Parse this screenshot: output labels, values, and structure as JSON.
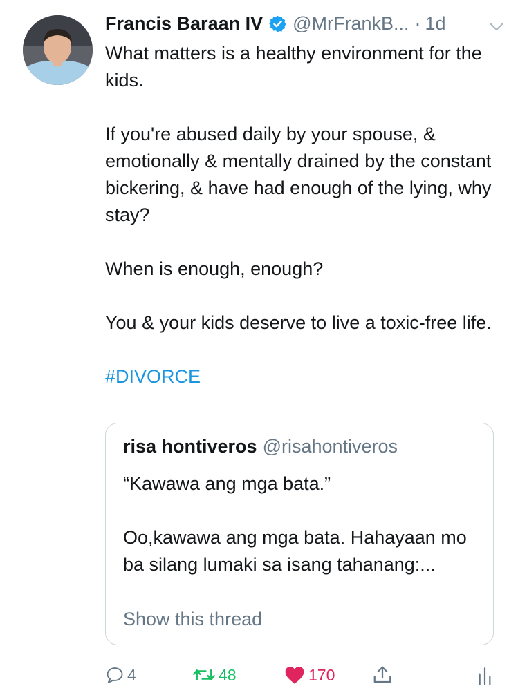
{
  "tweet": {
    "author": {
      "display_name": "Francis Baraan IV",
      "handle": "@MrFrankB...",
      "verified": true
    },
    "separator": "·",
    "time": "1d",
    "paragraphs": [
      "What matters is a healthy environment for the kids.",
      "If you're abused daily by your spouse, & emotionally & mentally drained by the constant bickering, & have had enough of the lying, why stay?",
      "When is enough, enough?",
      "You & your kids deserve to live a toxic-free life."
    ],
    "hashtag": "#DIVORCE",
    "quoted": {
      "display_name": "risa hontiveros",
      "handle": "@risahontiveros",
      "paragraphs": [
        "“Kawawa ang mga bata.”",
        "Oo,kawawa ang mga bata. Hahayaan mo ba silang lumaki sa isang tahanang:..."
      ],
      "show_thread": "Show this thread"
    },
    "actions": {
      "reply_count": "4",
      "retweet_count": "48",
      "like_count": "170"
    },
    "colors": {
      "link": "#1b95e0",
      "secondary_text": "#657786",
      "retweet": "#17bf63",
      "like": "#e0245e",
      "verified": "#1da1f2"
    },
    "icons": {
      "reply": "reply-icon",
      "retweet": "retweet-icon",
      "like": "heart-icon",
      "share": "share-icon",
      "analytics": "analytics-icon",
      "menu": "chevron-down-icon",
      "verified": "verified-badge-icon"
    }
  }
}
